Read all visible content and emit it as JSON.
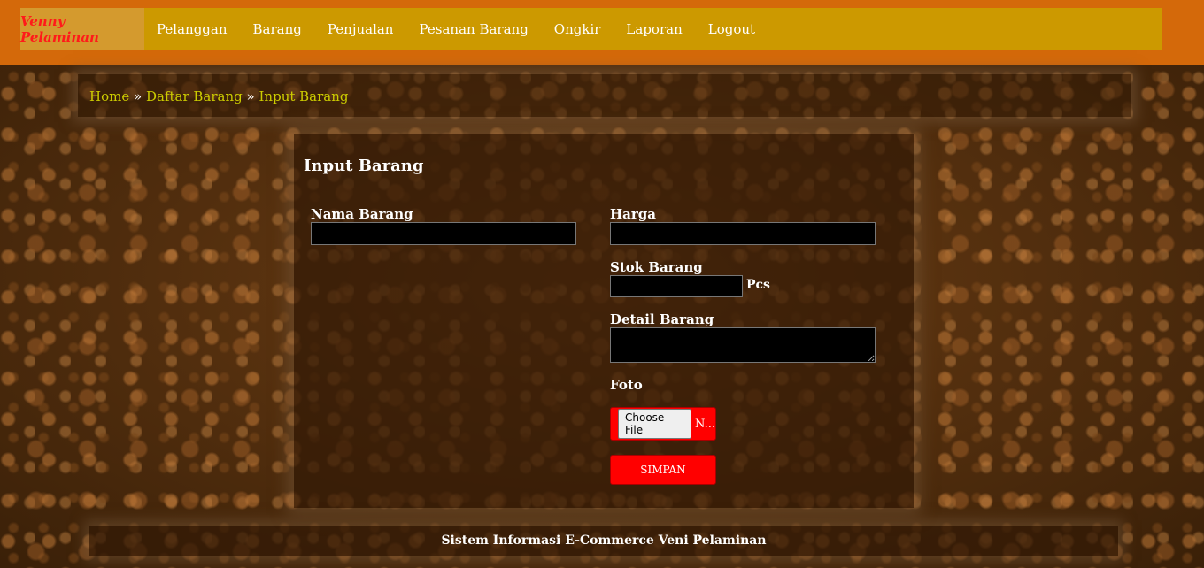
{
  "nav": {
    "brand": "Venny Pelaminan",
    "items": [
      "Pelanggan",
      "Barang",
      "Penjualan",
      "Pesanan Barang",
      "Ongkir",
      "Laporan",
      "Logout"
    ]
  },
  "breadcrumb": {
    "home": "Home",
    "separator": "»",
    "list": "Daftar Barang",
    "current": "Input Barang"
  },
  "form": {
    "title": "Input Barang",
    "nama_label": "Nama Barang",
    "nama_value": "",
    "harga_label": "Harga",
    "harga_value": "",
    "stok_label": "Stok Barang",
    "stok_value": "",
    "stok_unit": "Pcs",
    "detail_label": "Detail Barang",
    "detail_value": "",
    "foto_label": "Foto",
    "choose_file": "Choose File",
    "file_status": "N...",
    "save_label": "SIMPAN"
  },
  "footer": {
    "text": "Sistem Informasi E-Commerce Veni Pelaminan"
  },
  "colors": {
    "topbar": "#d4690a",
    "navbar": "#cc9900",
    "brand_text": "#ff1a1a",
    "breadcrumb_link": "#cccc00",
    "button": "#ff0000"
  }
}
